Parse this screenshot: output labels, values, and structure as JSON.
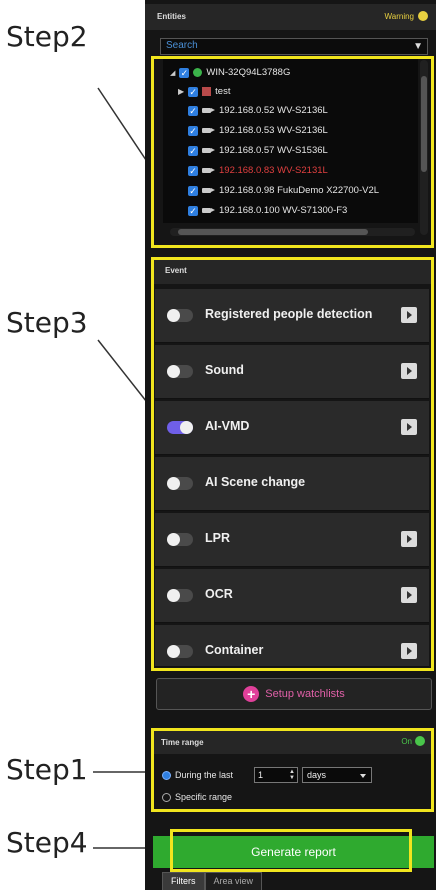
{
  "steps": {
    "s1": "Step1",
    "s2": "Step2",
    "s3": "Step3",
    "s4": "Step4"
  },
  "entities": {
    "title": "Entities",
    "warning": "Warning",
    "search_placeholder": "Search",
    "tree": [
      {
        "label": "WIN-32Q94L3788G"
      },
      {
        "label": "test"
      },
      {
        "label": "192.168.0.52 WV-S2136L"
      },
      {
        "label": "192.168.0.53 WV-S2136L"
      },
      {
        "label": "192.168.0.57 WV-S1536L"
      },
      {
        "label": "192.168.0.83 WV-S2131L"
      },
      {
        "label": "192.168.0.98 FukuDemo X22700-V2L"
      },
      {
        "label": "192.168.0.100 WV-S71300-F3"
      }
    ]
  },
  "event": {
    "title": "Event",
    "items": [
      {
        "label": "Registered people detection",
        "enabled": false
      },
      {
        "label": "Sound",
        "enabled": false
      },
      {
        "label": "AI-VMD",
        "enabled": true
      },
      {
        "label": "AI Scene change",
        "enabled": false
      },
      {
        "label": "LPR",
        "enabled": false
      },
      {
        "label": "OCR",
        "enabled": false
      },
      {
        "label": "Container",
        "enabled": false
      }
    ]
  },
  "setup_watchlists": "Setup watchlists",
  "time_range": {
    "title": "Time range",
    "status": "On",
    "during_label": "During the last",
    "count": "1",
    "unit": "days",
    "specific_label": "Specific range"
  },
  "generate_report": "Generate report",
  "tabs": [
    "Filters",
    "Area view"
  ],
  "colors": {
    "accent_yellow": "#f1e51e",
    "toggle_on": "#6f5fe8",
    "generate_green": "#2faa2f",
    "error_red": "#e04040"
  }
}
